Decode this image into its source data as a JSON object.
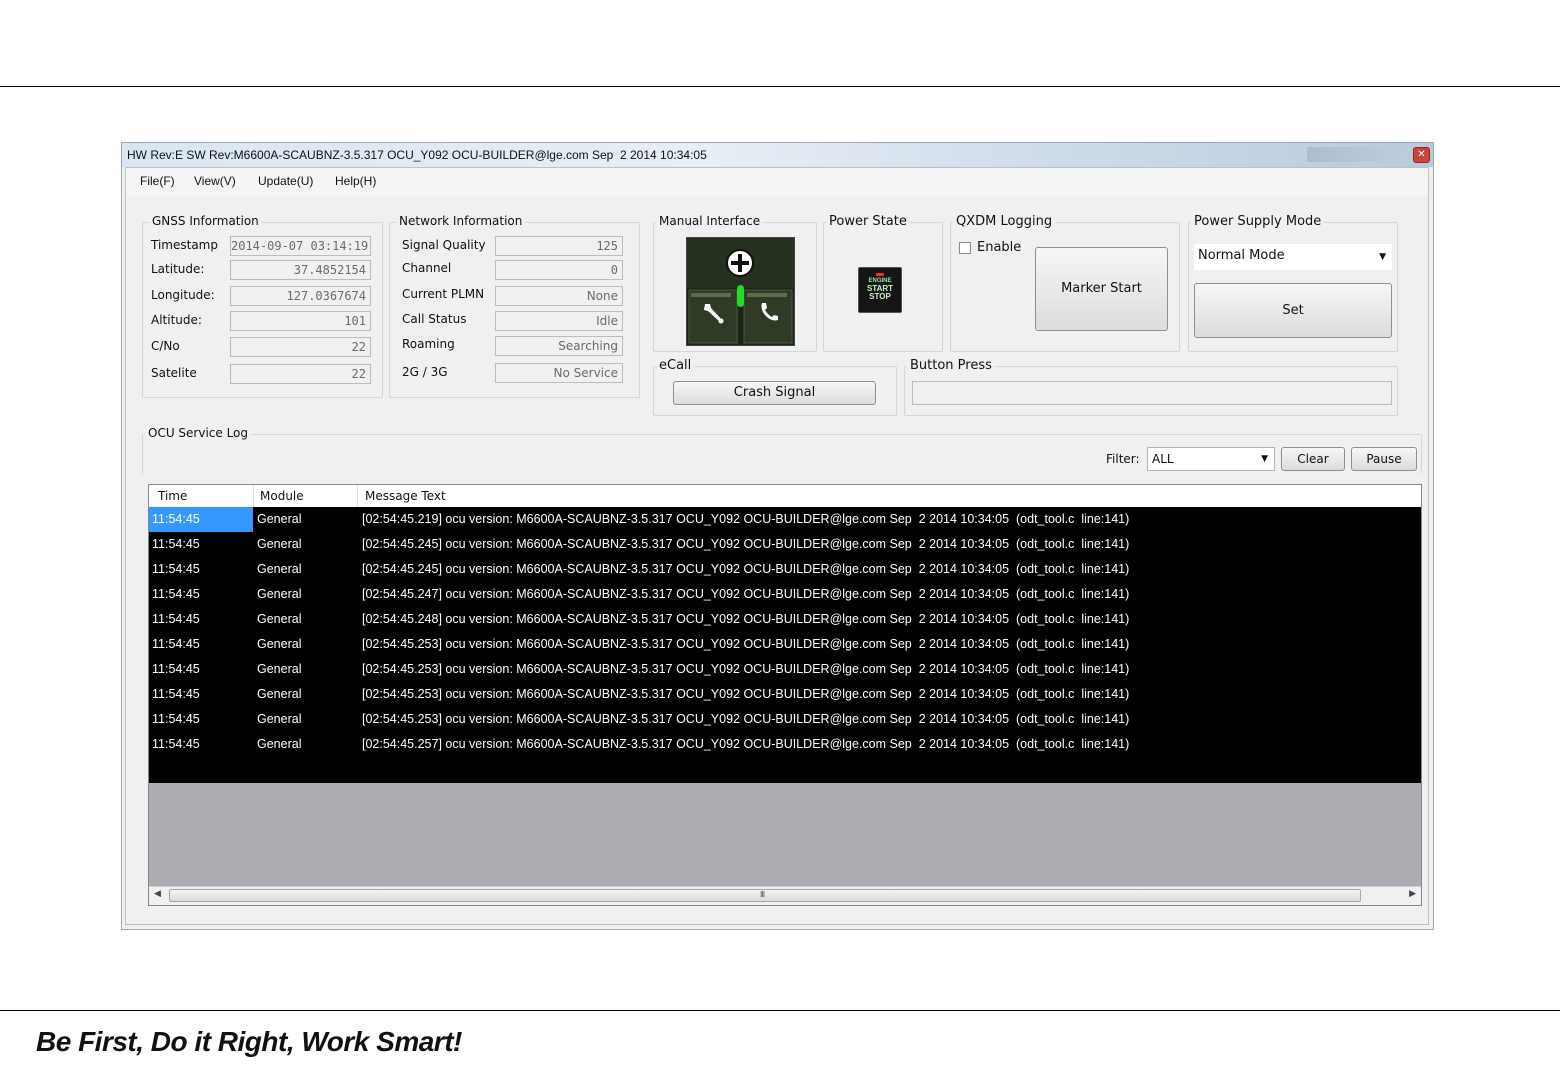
{
  "window": {
    "title": "HW Rev:E SW Rev:M6600A-SCAUBNZ-3.5.317 OCU_Y092 OCU-BUILDER@lge.com Sep  2 2014 10:34:05"
  },
  "menu": [
    "File(F)",
    "View(V)",
    "Update(U)",
    "Help(H)"
  ],
  "gnss": {
    "title": "GNSS Information",
    "rows": [
      {
        "label": "Timestamp",
        "value": "2014-09-07 03:14:19"
      },
      {
        "label": "Latitude:",
        "value": "37.4852154"
      },
      {
        "label": "Longitude:",
        "value": "127.0367674"
      },
      {
        "label": "Altitude:",
        "value": "101"
      },
      {
        "label": "C/No",
        "value": "22"
      },
      {
        "label": "Satelite",
        "value": "22"
      }
    ]
  },
  "network": {
    "title": "Network Information",
    "rows": [
      {
        "label": "Signal Quality",
        "value": "125"
      },
      {
        "label": "Channel",
        "value": "0"
      },
      {
        "label": "Current PLMN",
        "value": "None"
      },
      {
        "label": "Call Status",
        "value": "Idle"
      },
      {
        "label": "Roaming",
        "value": "Searching"
      },
      {
        "label": "2G / 3G",
        "value": "No Service"
      }
    ]
  },
  "manual": {
    "title": "Manual Interface"
  },
  "power_state": {
    "title": "Power State",
    "button_lines": [
      "ENGINE",
      "START",
      "STOP"
    ]
  },
  "qxdm": {
    "title": "QXDM Logging",
    "enable_label": "Enable",
    "enable_checked": false,
    "marker_button": "Marker Start"
  },
  "power_supply": {
    "title": "Power Supply Mode",
    "selected": "Normal Mode",
    "set_button": "Set"
  },
  "ecall": {
    "title": "eCall",
    "crash_button": "Crash Signal"
  },
  "button_press": {
    "title": "Button Press",
    "value": ""
  },
  "log": {
    "title": "OCU Service Log",
    "filter_label": "Filter:",
    "filter_value": "ALL",
    "clear_button": "Clear",
    "pause_button": "Pause",
    "columns": [
      "Time",
      "Module",
      "Message Text"
    ],
    "rows": [
      {
        "time": "11:54:45",
        "module": "General",
        "text": "[02:54:45.219] ocu version: M6600A-SCAUBNZ-3.5.317 OCU_Y092 OCU-BUILDER@lge.com Sep  2 2014 10:34:05  (odt_tool.c  line:141)"
      },
      {
        "time": "11:54:45",
        "module": "General",
        "text": "[02:54:45.245] ocu version: M6600A-SCAUBNZ-3.5.317 OCU_Y092 OCU-BUILDER@lge.com Sep  2 2014 10:34:05  (odt_tool.c  line:141)"
      },
      {
        "time": "11:54:45",
        "module": "General",
        "text": "[02:54:45.245] ocu version: M6600A-SCAUBNZ-3.5.317 OCU_Y092 OCU-BUILDER@lge.com Sep  2 2014 10:34:05  (odt_tool.c  line:141)"
      },
      {
        "time": "11:54:45",
        "module": "General",
        "text": "[02:54:45.247] ocu version: M6600A-SCAUBNZ-3.5.317 OCU_Y092 OCU-BUILDER@lge.com Sep  2 2014 10:34:05  (odt_tool.c  line:141)"
      },
      {
        "time": "11:54:45",
        "module": "General",
        "text": "[02:54:45.248] ocu version: M6600A-SCAUBNZ-3.5.317 OCU_Y092 OCU-BUILDER@lge.com Sep  2 2014 10:34:05  (odt_tool.c  line:141)"
      },
      {
        "time": "11:54:45",
        "module": "General",
        "text": "[02:54:45.253] ocu version: M6600A-SCAUBNZ-3.5.317 OCU_Y092 OCU-BUILDER@lge.com Sep  2 2014 10:34:05  (odt_tool.c  line:141)"
      },
      {
        "time": "11:54:45",
        "module": "General",
        "text": "[02:54:45.253] ocu version: M6600A-SCAUBNZ-3.5.317 OCU_Y092 OCU-BUILDER@lge.com Sep  2 2014 10:34:05  (odt_tool.c  line:141)"
      },
      {
        "time": "11:54:45",
        "module": "General",
        "text": "[02:54:45.253] ocu version: M6600A-SCAUBNZ-3.5.317 OCU_Y092 OCU-BUILDER@lge.com Sep  2 2014 10:34:05  (odt_tool.c  line:141)"
      },
      {
        "time": "11:54:45",
        "module": "General",
        "text": "[02:54:45.253] ocu version: M6600A-SCAUBNZ-3.5.317 OCU_Y092 OCU-BUILDER@lge.com Sep  2 2014 10:34:05  (odt_tool.c  line:141)"
      },
      {
        "time": "11:54:45",
        "module": "General",
        "text": "[02:54:45.257] ocu version: M6600A-SCAUBNZ-3.5.317 OCU_Y092 OCU-BUILDER@lge.com Sep  2 2014 10:34:05  (odt_tool.c  line:141)"
      }
    ],
    "scroll_grip": "III"
  },
  "slogan": "Be First, Do it Right, Work Smart!",
  "colors": {
    "log_background": "#000000",
    "selection": "#3399ff",
    "window_frame": "#9aa8b8",
    "close_button": "#c9453a",
    "indicator_green": "#22dd22"
  },
  "icons": [
    "plus-icon",
    "wrench-icon",
    "phone-icon",
    "close-icon",
    "chevron-down-icon",
    "scroll-left-icon",
    "scroll-right-icon"
  ]
}
